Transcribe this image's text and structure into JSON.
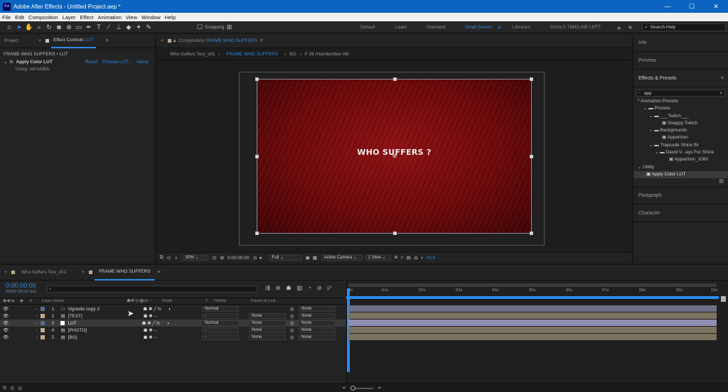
{
  "window": {
    "app_title": "Adobe After Effects - Untitled Project.aep *",
    "logo": "Ae",
    "minimize": "—",
    "maximize": "☐",
    "close": "✕"
  },
  "menu": [
    "File",
    "Edit",
    "Composition",
    "Layer",
    "Effect",
    "Animation",
    "View",
    "Window",
    "Help"
  ],
  "toolbar": {
    "snapping": "Snapping"
  },
  "workspaces": [
    "Default",
    "Learn",
    "Standard",
    "Small Screen",
    "Libraries",
    "DUALS TIMELINE LEFT"
  ],
  "active_workspace": "Small Screen",
  "workspace_more": "»",
  "search_help": "Search Help",
  "left_panel": {
    "tab_project": "Project",
    "tab_effect_controls": "Effect Controls",
    "tab_effect_controls_target": "LUT",
    "layer_path": "FRAME WHO SUFFERS • LUT",
    "effect_badge": "fx",
    "effect_name": "Apply Color LUT",
    "reset": "Reset",
    "choose_lut": "Choose LUT...",
    "about": "About",
    "using": "Using: red lut3DL"
  },
  "comp_panel": {
    "tab_label": "Composition",
    "comp_name": "FRAME WHO SUFFERS",
    "breadcrumbs": [
      "Who Suffers Test_v01",
      "FRAME WHO SUFFERS",
      "BG",
      "F 06 /Handwritten 06/"
    ],
    "canvas_text": "WHO SUFFERS ?",
    "footer": {
      "zoom": "50%",
      "timecode": "0:00:00:00",
      "resolution": "Full",
      "camera": "Active Camera",
      "view": "1 View",
      "exposure": "+0.0"
    }
  },
  "right_panel": {
    "info": "Info",
    "preview": "Preview",
    "effects_presets": "Effects & Presets",
    "search_value": "app",
    "tree": [
      {
        "label": "* Animation Presets",
        "indent": 0
      },
      {
        "label": "Presets",
        "indent": 1
      },
      {
        "label": "___Twitch___",
        "indent": 2
      },
      {
        "label": "Snappy Twitch",
        "indent": 3
      },
      {
        "label": "Backgrounds",
        "indent": 2
      },
      {
        "label": "Apparition",
        "indent": 3
      },
      {
        "label": "Trapcode Shine ffx",
        "indent": 2
      },
      {
        "label": "David V...ays For Shine",
        "indent": 3
      },
      {
        "label": "Apparition_1080",
        "indent": 4
      },
      {
        "label": "Utility",
        "indent": 0
      },
      {
        "label": "Apply Color LUT",
        "indent": 1
      }
    ],
    "paragraph": "Paragraph",
    "character": "Character"
  },
  "timeline": {
    "tabs": [
      "Who Suffers Test_v01",
      "FRAME WHO SUFFERS"
    ],
    "timecode": "0:00:00:00",
    "fps": "00000 (25.00 fps)",
    "search_placeholder": "",
    "headers": {
      "num": "#",
      "layer_name": "Layer Name",
      "mode": "Mode",
      "t": "T",
      "trkmat": "TrkMat",
      "parent": "Parent & Link"
    },
    "ruler": [
      "0s",
      "01s",
      "02s",
      "03s",
      "04s",
      "05s",
      "06s",
      "07s",
      "08s",
      "09s",
      "10s"
    ],
    "layers": [
      {
        "num": "1",
        "name": "Vignette copy 2",
        "mode": "Normal",
        "trkmat": "",
        "parent": "None",
        "color": "#5a6b94"
      },
      {
        "num": "2",
        "name": "[TEXT]",
        "mode": "-",
        "trkmat": "None",
        "parent": "None",
        "color": "#bfa98a"
      },
      {
        "num": "3",
        "name": "LUT",
        "mode": "Normal",
        "trkmat": "None",
        "parent": "None",
        "color": "#ffffff"
      },
      {
        "num": "4",
        "name": "[PHOTO]",
        "mode": "-",
        "trkmat": "None",
        "parent": "None",
        "color": "#bfa98a"
      },
      {
        "num": "5",
        "name": "[BG]",
        "mode": "-",
        "trkmat": "None",
        "parent": "None",
        "color": "#bfa98a"
      }
    ]
  },
  "colors": {
    "accent": "#2d8ceb",
    "titlebar": "#0a64c0",
    "canvas_red": "#7a0a0c"
  }
}
